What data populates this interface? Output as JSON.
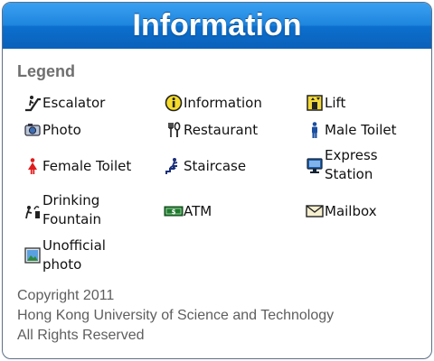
{
  "header": {
    "title": "Information"
  },
  "legend": {
    "heading": "Legend",
    "items": [
      {
        "label": "Escalator",
        "icon": "escalator-icon"
      },
      {
        "label": "Information",
        "icon": "information-icon"
      },
      {
        "label": "Lift",
        "icon": "lift-icon"
      },
      {
        "label": "Photo",
        "icon": "photo-icon"
      },
      {
        "label": "Restaurant",
        "icon": "restaurant-icon"
      },
      {
        "label": "Male Toilet",
        "icon": "male-toilet-icon"
      },
      {
        "label": "Female Toilet",
        "icon": "female-toilet-icon"
      },
      {
        "label": "Staircase",
        "icon": "staircase-icon"
      },
      {
        "label": "Express Station",
        "icon": "express-station-icon"
      },
      {
        "label": "Drinking Fountain",
        "icon": "drinking-fountain-icon"
      },
      {
        "label": "ATM",
        "icon": "atm-icon"
      },
      {
        "label": "Mailbox",
        "icon": "mailbox-icon"
      },
      {
        "label": "Unofficial photo",
        "icon": "unofficial-photo-icon"
      }
    ]
  },
  "footer": {
    "lines": [
      "Copyright 2011",
      "Hong Kong University of Science and Technology",
      "All Rights Reserved"
    ]
  },
  "colors": {
    "header_blue": "#1f86df",
    "male_blue": "#1a4fa0",
    "female_red": "#e01b1b",
    "atm_green": "#1f7a2e"
  }
}
